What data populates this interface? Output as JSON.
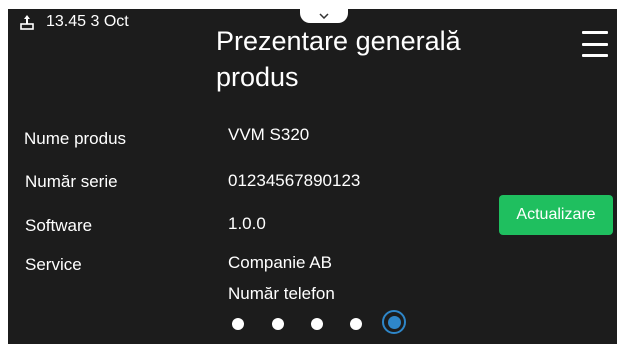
{
  "status": {
    "time_date": "13.45 3 Oct",
    "left_icon": "usb-icon"
  },
  "header": {
    "title": "Prezentare generală produs",
    "menu_icon": "hamburger-menu-icon",
    "pull_tab_icon": "chevron-down-icon"
  },
  "info": {
    "product_name_label": "Nume produs",
    "product_name_value": "VVM S320",
    "serial_label": "Număr serie",
    "serial_value": "01234567890123",
    "software_label": "Software",
    "software_value": "1.0.0",
    "service_label": "Service",
    "service_company": "Companie AB",
    "service_phone": "Număr telefon"
  },
  "actions": {
    "update_label": "Actualizare"
  },
  "pager": {
    "total_pages": 5,
    "current_page": 5
  },
  "colors": {
    "background": "#1c1c1c",
    "text": "#ffffff",
    "update_button": "#1fbf5f",
    "active_page_dot": "#2e86c8"
  }
}
